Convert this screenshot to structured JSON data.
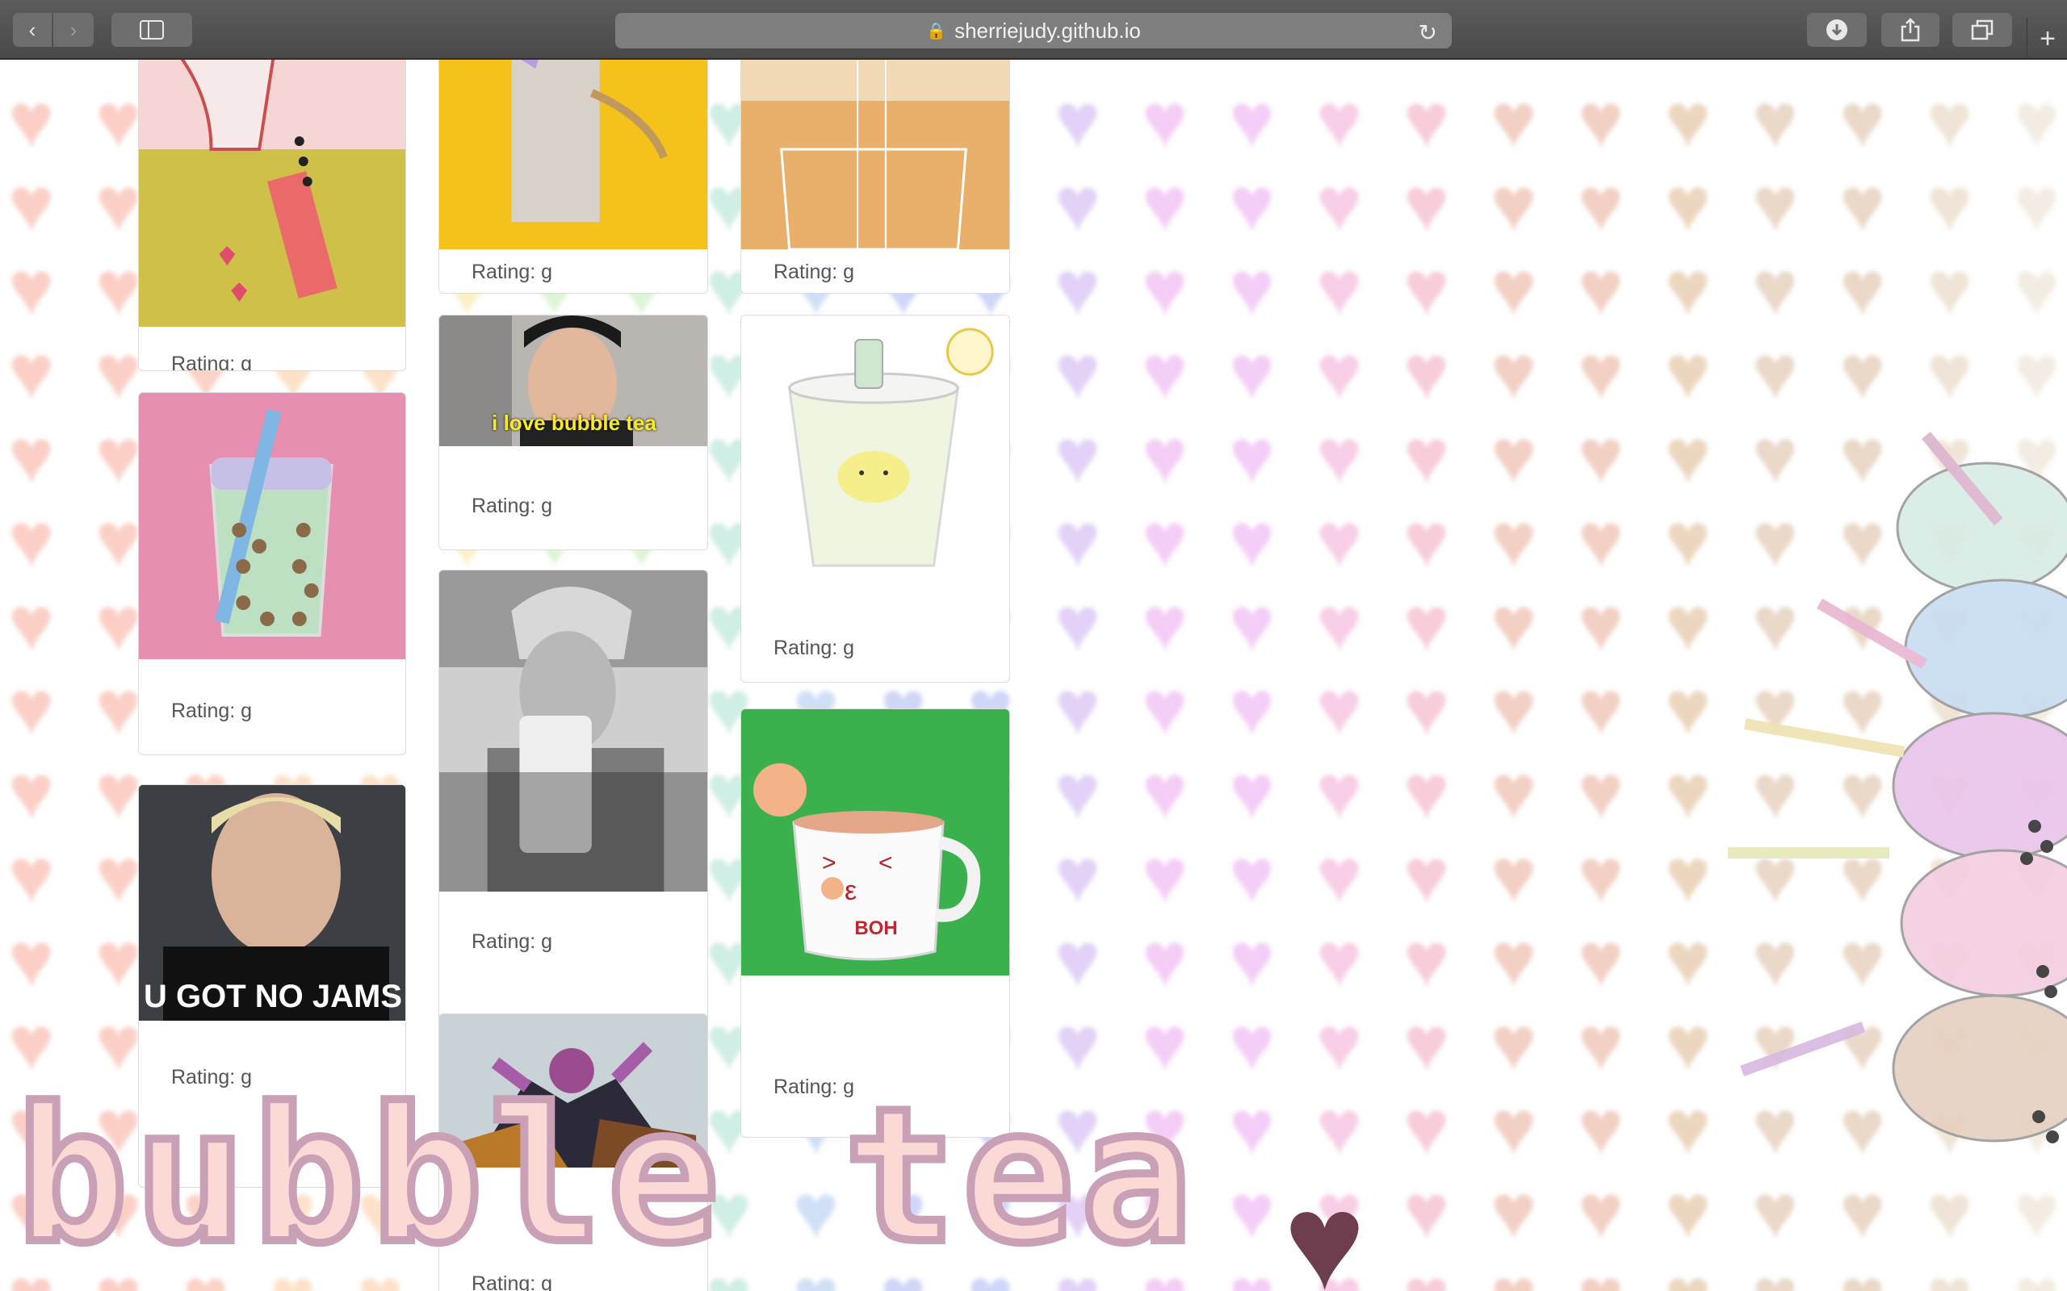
{
  "browser": {
    "url": "sherriejudy.github.io",
    "icons": {
      "back": "chevron-left-icon",
      "forward": "chevron-right-icon",
      "sidebar": "sidebar-icon",
      "lock": "lock-icon",
      "reload": "reload-icon",
      "download": "download-icon",
      "share": "share-icon",
      "tabs": "tabs-icon",
      "new_tab": "plus-icon"
    }
  },
  "cards": [
    {
      "caption": "",
      "rating": "Rating: g"
    },
    {
      "caption": "",
      "rating": "Rating: g"
    },
    {
      "caption": "",
      "rating": "Rating: g"
    },
    {
      "caption": "i love bubble tea",
      "rating": "Rating: g"
    },
    {
      "caption": "",
      "rating": "Rating: g"
    },
    {
      "caption": "",
      "rating": "Rating: g"
    },
    {
      "caption": "U GOT NO JAMS",
      "rating": "Rating: g"
    },
    {
      "caption": "",
      "rating": "Rating: g"
    },
    {
      "caption": "BOH",
      "rating": "Rating: g"
    },
    {
      "caption": "",
      "rating": "Rating: g"
    }
  ],
  "title": "bubble tea",
  "colors": {
    "toolbar": "#4f4f4f",
    "pink_gif_bg": "#e68fb0",
    "green_gif_bg": "#3bb14d",
    "yellow_gif_bg": "#f4c21b",
    "orange_gif_bg": "#e8b06a"
  }
}
